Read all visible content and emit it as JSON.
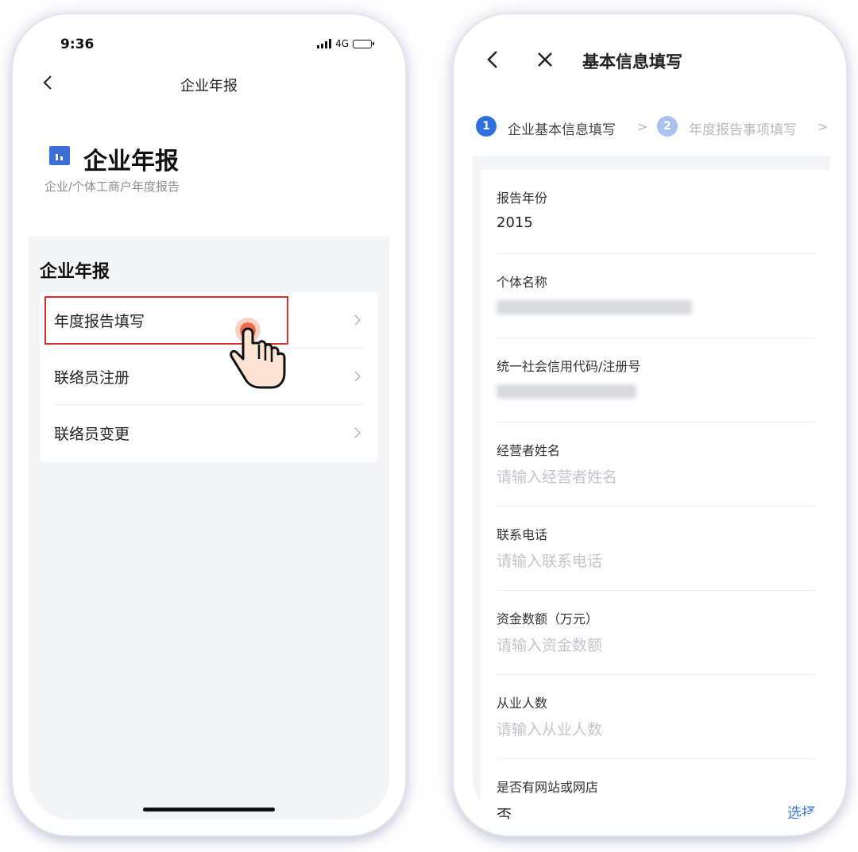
{
  "left_phone": {
    "status_bar": {
      "time": "9:36",
      "network": "4G"
    },
    "navbar": {
      "title": "企业年报"
    },
    "header": {
      "title": "企业年报",
      "subtitle": "企业/个体工商户年度报告"
    },
    "section_title": "企业年报",
    "menu": [
      {
        "label": "年度报告填写"
      },
      {
        "label": "联络员注册"
      },
      {
        "label": "联络员变更"
      }
    ]
  },
  "right_phone": {
    "title": "基本信息填写",
    "steps": [
      {
        "number": "1",
        "label": "企业基本信息填写"
      },
      {
        "number": "2",
        "label": "年度报告事项填写"
      }
    ],
    "fields": {
      "report_year": {
        "label": "报告年份",
        "value": "2015"
      },
      "entity_name": {
        "label": "个体名称"
      },
      "credit_code": {
        "label": "统一社会信用代码/注册号"
      },
      "operator_name": {
        "label": "经营者姓名",
        "placeholder": "请输入经营者姓名"
      },
      "phone": {
        "label": "联系电话",
        "placeholder": "请输入联系电话"
      },
      "capital": {
        "label": "资金数额（万元）",
        "placeholder": "请输入资金数额"
      },
      "employees": {
        "label": "从业人数",
        "placeholder": "请输入从业人数"
      },
      "website": {
        "label": "是否有网站或网店",
        "value": "否",
        "action": "选择"
      }
    }
  },
  "colors": {
    "accent_blue": "#3b78d8",
    "highlight_red": "#d9302f",
    "step_active": "#2f6fe0",
    "step_inactive": "#a9c2f0",
    "placeholder": "#c3c6cc"
  }
}
